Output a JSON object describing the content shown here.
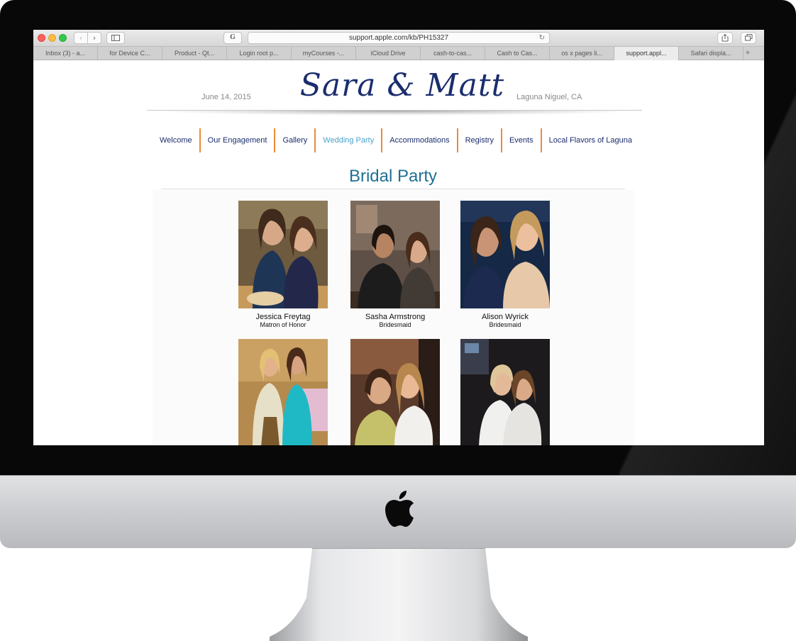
{
  "browser": {
    "url": "support.apple.com/kb/PH15327",
    "google_label": "G",
    "tabs": [
      "Inbox (3) - a...",
      "for Device C...",
      "Product - Qt...",
      "Login root p...",
      "myCourses -...",
      "iCloud Drive",
      "cash-to-cas...",
      "Cash to Cas...",
      "os x pages li...",
      "support.appl...",
      "Safari displa..."
    ],
    "active_tab_index": 9
  },
  "site": {
    "date": "June 14, 2015",
    "title": "Sara & Matt",
    "location": "Laguna Niguel, CA",
    "nav": [
      {
        "label": "Welcome"
      },
      {
        "label": "Our Engagement"
      },
      {
        "label": "Gallery"
      },
      {
        "label": "Wedding Party"
      },
      {
        "label": "Accommodations"
      },
      {
        "label": "Registry"
      },
      {
        "label": "Events"
      },
      {
        "label": "Local Flavors of Laguna"
      }
    ],
    "active_nav": "Wedding Party",
    "section_heading": "Bridal Party",
    "members": [
      {
        "name": "Jessica Freytag",
        "role": "Matron of Honor"
      },
      {
        "name": "Sasha Armstrong",
        "role": "Bridesmaid"
      },
      {
        "name": "Alison Wyrick",
        "role": "Bridesmaid"
      },
      {
        "name": "",
        "role": ""
      },
      {
        "name": "",
        "role": ""
      },
      {
        "name": "",
        "role": ""
      }
    ]
  },
  "colors": {
    "title_navy": "#1b2d6e",
    "nav_divider_orange": "#e98b3b",
    "nav_active_blue": "#4aa3cf",
    "heading_teal": "#1f6f94"
  }
}
